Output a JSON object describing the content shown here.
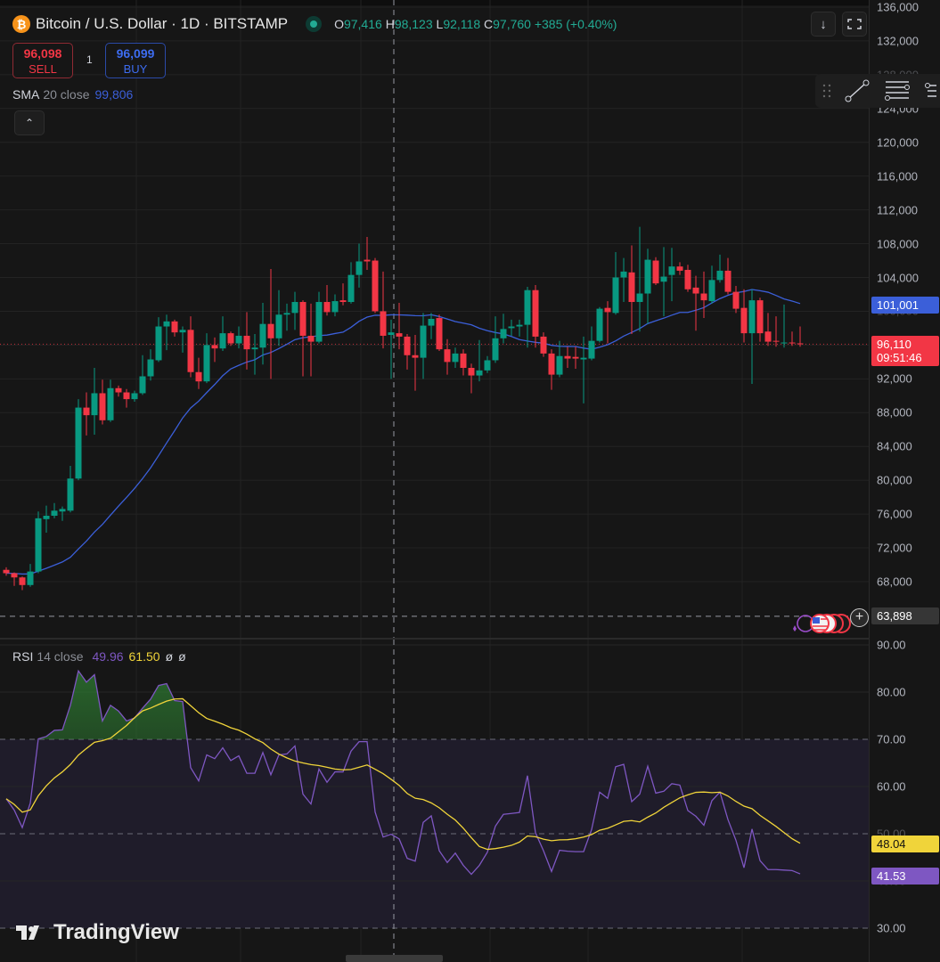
{
  "header": {
    "symbol_title": "Bitcoin / U.S. Dollar · 1D · BITSTAMP",
    "coin_glyph": "₿",
    "o_label": "O",
    "o": "97,416",
    "h_label": "H",
    "h": "98,123",
    "l_label": "L",
    "l": "92,118",
    "c_label": "C",
    "c": "97,760",
    "change": "+385 (+0.40%)"
  },
  "trade": {
    "sell_price": "96,098",
    "sell_label": "SELL",
    "spread": "1",
    "buy_price": "96,099",
    "buy_label": "BUY"
  },
  "sma_legend": {
    "name": "SMA",
    "params": "20 close",
    "value": "99,806"
  },
  "rsi_legend": {
    "name": "RSI",
    "params": "14 close",
    "value": "49.96",
    "ma_value": "61.50",
    "extra1": "ø",
    "extra2": "ø"
  },
  "colors": {
    "up": "#089981",
    "down": "#f23645",
    "sma": "#3b5fd9",
    "rsi": "#7e57c2",
    "rsi_ma": "#f0d43a"
  },
  "price_axis": [
    "136,000",
    "132,000",
    "128,000",
    "124,000",
    "120,000",
    "116,000",
    "112,000",
    "108,000",
    "104,000",
    "100,000",
    "96,000",
    "92,000",
    "88,000",
    "84,000",
    "80,000",
    "76,000",
    "72,000",
    "68,000"
  ],
  "price_axis_values": [
    136000,
    132000,
    128000,
    124000,
    120000,
    116000,
    112000,
    108000,
    104000,
    100000,
    96000,
    92000,
    88000,
    84000,
    80000,
    76000,
    72000,
    68000
  ],
  "rsi_axis": [
    "90.00",
    "80.00",
    "70.00",
    "60.00",
    "50.00",
    "40.00",
    "30.00"
  ],
  "rsi_axis_values": [
    90,
    80,
    70,
    60,
    50,
    40,
    30
  ],
  "labels": {
    "sma_last": "101,001",
    "last_price": "96,110",
    "countdown": "09:51:46",
    "crosshair_price": "63,898",
    "rsi_ma_last": "48.04",
    "rsi_last": "41.53"
  },
  "crosshair_price_value": 63898,
  "logo": "TradingView",
  "icons": {
    "download": "download-icon",
    "fullscreen": "fullscreen-icon",
    "drag": "drag-handle-icon",
    "trendline": "trend-line-icon",
    "hlines": "horizontal-lines-icon",
    "fib": "fib-icon"
  },
  "chart_data": {
    "type": "candlestick",
    "ohlc": [
      [
        69400,
        69700,
        68700,
        69000
      ],
      [
        69000,
        69100,
        67500,
        68500
      ],
      [
        68500,
        68600,
        67000,
        67600
      ],
      [
        67600,
        70100,
        67400,
        69200
      ],
      [
        69200,
        76300,
        69000,
        75500
      ],
      [
        75400,
        77000,
        73800,
        75800
      ],
      [
        75800,
        77300,
        75500,
        76400
      ],
      [
        76300,
        76900,
        75200,
        76600
      ],
      [
        76400,
        81700,
        76200,
        80200
      ],
      [
        80200,
        89600,
        80000,
        88600
      ],
      [
        88600,
        90400,
        85300,
        87700
      ],
      [
        87700,
        93300,
        85400,
        90300
      ],
      [
        90300,
        91900,
        86600,
        87100
      ],
      [
        87100,
        91900,
        86900,
        90900
      ],
      [
        90900,
        91200,
        89900,
        90400
      ],
      [
        90400,
        90800,
        88600,
        89600
      ],
      [
        89600,
        90600,
        89300,
        90300
      ],
      [
        90300,
        94800,
        90100,
        92300
      ],
      [
        92300,
        95500,
        91800,
        94300
      ],
      [
        94200,
        99300,
        94000,
        98200
      ],
      [
        98200,
        99600,
        95400,
        98800
      ],
      [
        98800,
        99000,
        97000,
        97500
      ],
      [
        97500,
        98200,
        95100,
        97800
      ],
      [
        97800,
        99400,
        92200,
        92800
      ],
      [
        92800,
        94500,
        90800,
        91700
      ],
      [
        91700,
        97400,
        91500,
        96000
      ],
      [
        96000,
        96900,
        94000,
        95600
      ],
      [
        95600,
        99400,
        95300,
        97400
      ],
      [
        97400,
        97600,
        95900,
        96200
      ],
      [
        96200,
        98200,
        95600,
        97100
      ],
      [
        97100,
        99900,
        93100,
        95500
      ],
      [
        95500,
        97300,
        92500,
        95700
      ],
      [
        95700,
        101000,
        93700,
        98500
      ],
      [
        98500,
        105000,
        92000,
        96800
      ],
      [
        96800,
        102500,
        95900,
        99600
      ],
      [
        99600,
        100900,
        97700,
        99800
      ],
      [
        99800,
        102300,
        97800,
        101100
      ],
      [
        101100,
        101300,
        92300,
        97100
      ],
      [
        97100,
        100900,
        92300,
        96400
      ],
      [
        96400,
        102300,
        96200,
        101100
      ],
      [
        101100,
        103100,
        99500,
        99900
      ],
      [
        99900,
        102000,
        99400,
        101200
      ],
      [
        101300,
        103300,
        100700,
        101100
      ],
      [
        101100,
        105800,
        100900,
        104300
      ],
      [
        104300,
        108000,
        102800,
        105900
      ],
      [
        106100,
        108800,
        104900,
        105900
      ],
      [
        106000,
        106300,
        99800,
        100000
      ],
      [
        100000,
        104700,
        95600,
        97100
      ],
      [
        97200,
        99000,
        92000,
        97500
      ],
      [
        97400,
        101000,
        95500,
        97000
      ],
      [
        97000,
        97300,
        93100,
        94800
      ],
      [
        94800,
        97200,
        90600,
        94500
      ],
      [
        94500,
        99800,
        92000,
        98300
      ],
      [
        98300,
        99800,
        96700,
        99100
      ],
      [
        99200,
        99600,
        95300,
        95500
      ],
      [
        95500,
        96700,
        92500,
        94000
      ],
      [
        94000,
        95700,
        93300,
        95000
      ],
      [
        95000,
        95500,
        92400,
        93300
      ],
      [
        93300,
        93800,
        90300,
        92400
      ],
      [
        92400,
        96600,
        91700,
        93000
      ],
      [
        93000,
        94700,
        92700,
        94200
      ],
      [
        94200,
        99400,
        93900,
        96800
      ],
      [
        96800,
        99700,
        96200,
        97900
      ],
      [
        98000,
        99000,
        97100,
        98200
      ],
      [
        98200,
        99000,
        97000,
        98400
      ],
      [
        98400,
        102900,
        95700,
        102500
      ],
      [
        102500,
        103100,
        95700,
        97000
      ],
      [
        97000,
        97500,
        94600,
        95000
      ],
      [
        95000,
        95500,
        90700,
        92500
      ],
      [
        92500,
        96500,
        92200,
        94700
      ],
      [
        94700,
        95800,
        93300,
        94400
      ],
      [
        94600,
        95800,
        93200,
        94400
      ],
      [
        94300,
        97000,
        89100,
        94500
      ],
      [
        94400,
        98200,
        94200,
        96500
      ],
      [
        96500,
        100500,
        96300,
        100300
      ],
      [
        100400,
        101200,
        96200,
        99900
      ],
      [
        99800,
        107000,
        99600,
        104000
      ],
      [
        104000,
        106300,
        101100,
        104700
      ],
      [
        104600,
        107800,
        97300,
        101100
      ],
      [
        101100,
        110000,
        97600,
        102100
      ],
      [
        102100,
        107400,
        98500,
        106100
      ],
      [
        106000,
        106400,
        103100,
        103300
      ],
      [
        103500,
        107600,
        99400,
        104100
      ],
      [
        104300,
        107500,
        101200,
        105300
      ],
      [
        105300,
        105800,
        104300,
        104800
      ],
      [
        104900,
        105500,
        102300,
        102600
      ],
      [
        102800,
        104200,
        97700,
        102100
      ],
      [
        102100,
        104700,
        99200,
        101300
      ],
      [
        101200,
        105400,
        100900,
        103700
      ],
      [
        103700,
        106700,
        103400,
        104800
      ],
      [
        104800,
        106300,
        102000,
        102300
      ],
      [
        102300,
        103000,
        99800,
        100300
      ],
      [
        100400,
        102600,
        96300,
        97400
      ],
      [
        97400,
        102600,
        91400,
        101300
      ],
      [
        101300,
        101600,
        96400,
        97400
      ],
      [
        97600,
        99800,
        95900,
        96400
      ],
      [
        96500,
        99400,
        95800,
        96400
      ],
      [
        96300,
        100800,
        95700,
        96300
      ],
      [
        96300,
        97600,
        95900,
        96200
      ],
      [
        96200,
        98200,
        95800,
        96110
      ]
    ],
    "sma_period": 20,
    "rsi": [
      57.4,
      55,
      51.3,
      56.5,
      70.1,
      70.6,
      71.9,
      72,
      77.2,
      84.5,
      82.1,
      83.7,
      73.9,
      77.2,
      76,
      73.9,
      74.5,
      76.6,
      78.5,
      81.4,
      81.8,
      78.2,
      78,
      64,
      61.2,
      66.7,
      65.9,
      68.2,
      65.5,
      66.5,
      62.8,
      62.8,
      67.2,
      62.5,
      66.7,
      66.9,
      68.6,
      58.4,
      56.3,
      63.7,
      60.9,
      63.1,
      63.1,
      67.5,
      69.5,
      69.5,
      54.6,
      49.3,
      49.9,
      48.9,
      44.8,
      44.2,
      52.4,
      53.8,
      46.4,
      43.9,
      45.9,
      43.3,
      41.4,
      43.3,
      46.1,
      51.6,
      54.1,
      54.3,
      54.5,
      62.3,
      50.2,
      46.4,
      42,
      46.5,
      46.3,
      46.2,
      46.2,
      50.9,
      58.8,
      57.5,
      64.2,
      64.7,
      56.8,
      58.4,
      64.3,
      58.6,
      59,
      60.6,
      60.3,
      54.9,
      53.7,
      51.8,
      57,
      58.8,
      53,
      48.6,
      42.8,
      51,
      44.3,
      42.4,
      42.4,
      42.3,
      42.2,
      41.5
    ],
    "rsi_ma_period": 14,
    "rsi_bands": [
      70,
      50,
      30
    ],
    "ylim": [
      64000,
      137000
    ],
    "rsi_ylim": [
      25,
      91
    ]
  }
}
